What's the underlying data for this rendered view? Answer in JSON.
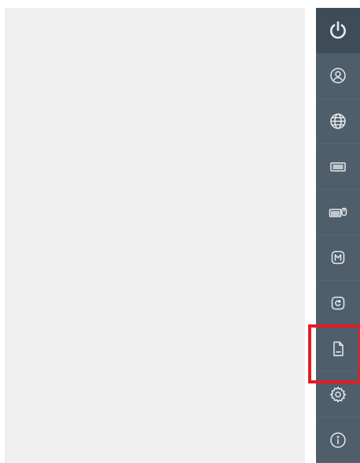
{
  "colors": {
    "sidebar_bg": "#4e5e6b",
    "top_item_bg": "#3e4c57",
    "content_bg": "#efefef",
    "icon_stroke": "#e6ebef",
    "highlight": "#e51c24"
  },
  "sidebar": {
    "items": [
      {
        "icon": "power-icon",
        "selected": false
      },
      {
        "icon": "user-icon",
        "selected": false
      },
      {
        "icon": "globe-icon",
        "selected": false
      },
      {
        "icon": "keyboard-icon",
        "selected": false
      },
      {
        "icon": "keyboard-mouse-icon",
        "selected": false
      },
      {
        "icon": "m-badge-icon",
        "selected": false
      },
      {
        "icon": "refresh-document-icon",
        "selected": false
      },
      {
        "icon": "document-icon",
        "selected": true
      },
      {
        "icon": "gear-icon",
        "selected": false
      },
      {
        "icon": "info-icon",
        "selected": false
      }
    ]
  }
}
